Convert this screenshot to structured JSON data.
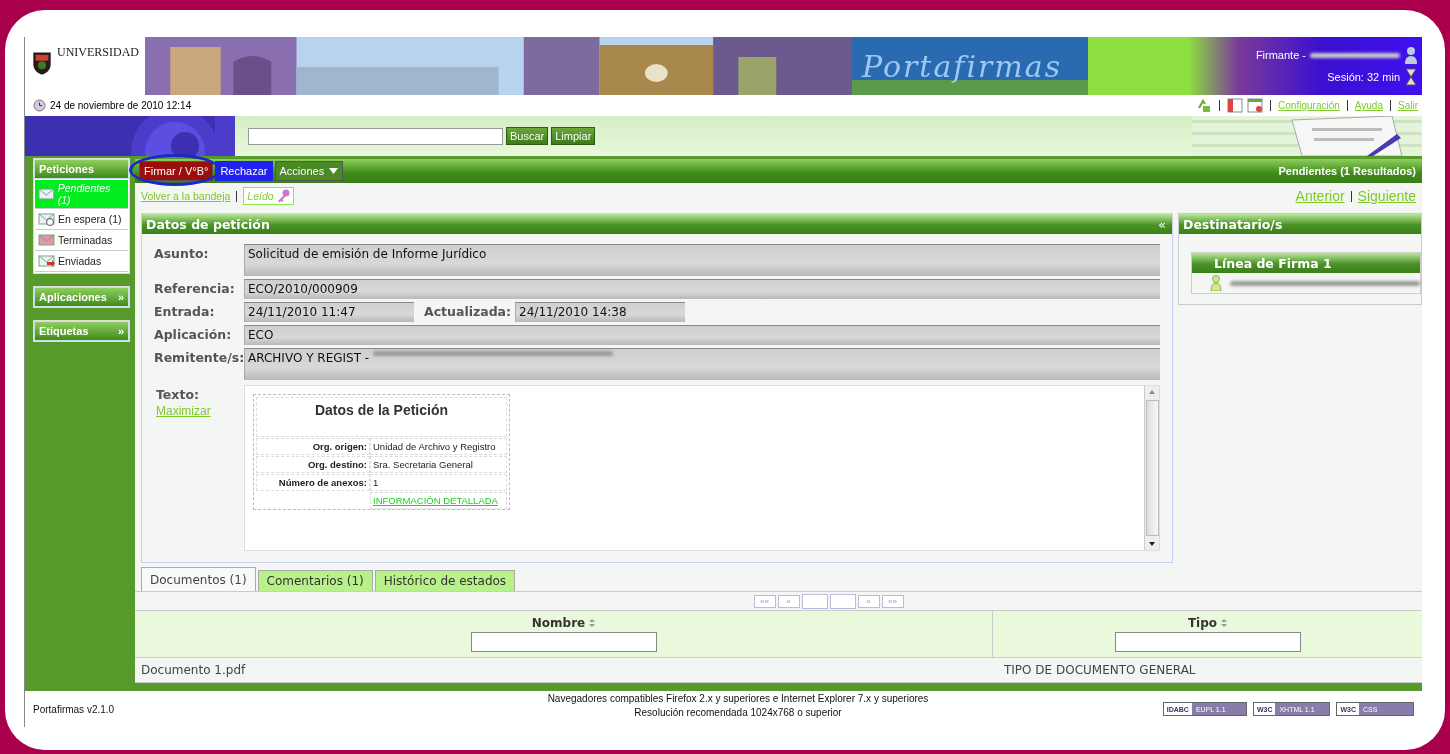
{
  "header": {
    "logo_text": "UNIVERSIDAD",
    "app_title": "Portafirmas",
    "signer_label": "Firmante -",
    "session": "Sesión: 32 min"
  },
  "date_bar": {
    "date": "24 de noviembre de 2010  12:14",
    "links": [
      "Configuración",
      "Ayuda",
      "Salir"
    ]
  },
  "search": {
    "buttons": [
      "Buscar",
      "Limpiar"
    ]
  },
  "sidebar": {
    "sections": [
      {
        "title": "Peticiones",
        "expanded": true,
        "items": [
          {
            "label": "Pendientes (1)",
            "selected": true
          },
          {
            "label": "En espera (1)",
            "selected": false
          },
          {
            "label": "Terminadas",
            "selected": false
          },
          {
            "label": "Enviadas",
            "selected": false
          }
        ]
      },
      {
        "title": "Aplicaciones",
        "expanded": false,
        "toggle": "»"
      },
      {
        "title": "Etiquetas",
        "expanded": false,
        "toggle": "»"
      }
    ]
  },
  "toolbar": {
    "actions": [
      {
        "label": "Firmar / V°B°",
        "kind": "sign",
        "highlighted": true
      },
      {
        "label": "Rechazar",
        "kind": "reject",
        "highlighted": false
      },
      {
        "label": "Acciones",
        "kind": "menu",
        "highlighted": false
      }
    ],
    "status": "Pendientes (1 Resultados)"
  },
  "nav": {
    "back": "Volver a la bandeja",
    "read": "Leído",
    "prev": "Anterior",
    "next": "Siguiente"
  },
  "request": {
    "title": "Datos de petición",
    "collapse": "«",
    "rows": [
      {
        "kind": "tall",
        "cells": [
          {
            "label": "Asunto:",
            "value": "Solicitud de emisión de Informe Jurídico",
            "redacted": false
          }
        ]
      },
      {
        "kind": "single",
        "cells": [
          {
            "label": "Referencia:",
            "value": "ECO/2010/000909",
            "redacted": false
          }
        ]
      },
      {
        "kind": "pair",
        "cells": [
          {
            "label": "Entrada:",
            "value": "24/11/2010 11:47",
            "redacted": false
          },
          {
            "label": "Actualizada:",
            "value": "24/11/2010 14:38",
            "redacted": false
          }
        ]
      },
      {
        "kind": "single",
        "cells": [
          {
            "label": "Aplicación:",
            "value": "ECO",
            "redacted": false
          }
        ]
      },
      {
        "kind": "tall",
        "cells": [
          {
            "label": "Remitente/s:",
            "value": "ARCHIVO Y REGIST - ",
            "redacted": true
          }
        ]
      }
    ],
    "text_label": "Texto:",
    "maximize": "Maximizar",
    "document": {
      "title": "Datos de la Petición",
      "rows": [
        {
          "label": "Org. origen:",
          "value": "Unidad de Archivo y Registro"
        },
        {
          "label": "Org. destino:",
          "value": "Sra. Secretaria General"
        },
        {
          "label": "Número de anexos:",
          "value": "1"
        }
      ],
      "link": "INFORMACIÓN DETALLADA"
    }
  },
  "recipients": {
    "title": "Destinatario/s",
    "lines": [
      {
        "title": "Línea de Firma 1",
        "signers": [
          {
            "redacted": true
          }
        ]
      }
    ]
  },
  "tabs": [
    {
      "label": "Documentos (1)",
      "selected": true
    },
    {
      "label": "Comentarios (1)",
      "selected": false
    },
    {
      "label": "Histórico de estados",
      "selected": false
    }
  ],
  "pager": [
    "««",
    "«",
    "»",
    "»»"
  ],
  "table": {
    "columns": [
      "Nombre",
      "Tipo"
    ],
    "rows": [
      [
        "Documento 1.pdf",
        "TIPO DE DOCUMENTO GENERAL"
      ]
    ]
  },
  "footer": {
    "version": "Portafirmas v2.1.0",
    "notes": [
      "Navegadores compatibles Firefox 2.x y superiores e Internet Explorer 7.x y superiores",
      "Resolución recomendada 1024x768 o superior"
    ],
    "badges": [
      {
        "left": "IDABC",
        "right": "EUPL 1.1"
      },
      {
        "left": "W3C",
        "right": "XHTML 1.1"
      },
      {
        "left": "W3C",
        "right": "CSS"
      }
    ]
  }
}
